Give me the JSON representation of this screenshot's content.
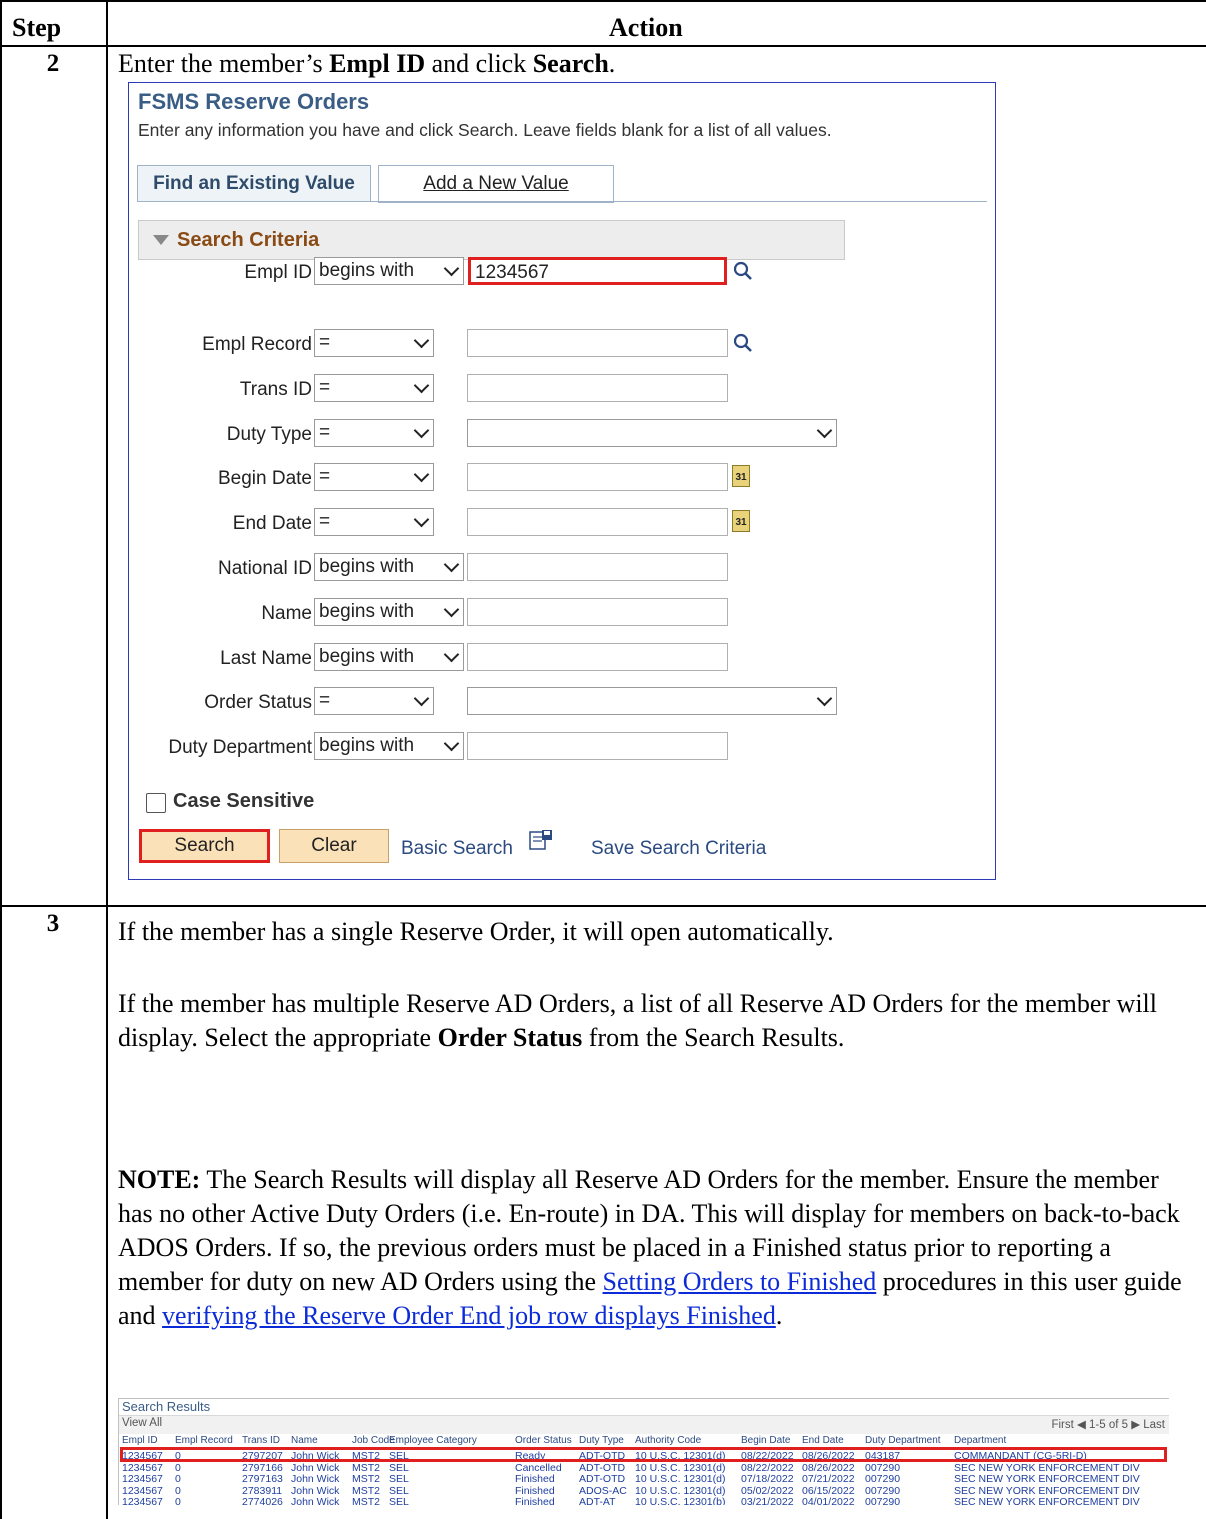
{
  "header": {
    "step": "Step",
    "action": "Action"
  },
  "step2": {
    "num": "2",
    "instr_pre": "Enter the member’s ",
    "instr_b1": "Empl ID",
    "instr_mid": " and click ",
    "instr_b2": "Search",
    "instr_end": "."
  },
  "ps": {
    "title": "FSMS Reserve Orders",
    "instructions": "Enter any information you have and click Search. Leave fields blank for a list of all values.",
    "tab_find": "Find an Existing Value",
    "tab_add": "Add a New Value",
    "criteria": "Search Criteria",
    "fields": [
      {
        "label": "Empl ID",
        "op": "begins with",
        "value": "1234567"
      },
      {
        "label": "Empl Record",
        "op": "=",
        "value": ""
      },
      {
        "label": "Trans ID",
        "op": "=",
        "value": ""
      },
      {
        "label": "Duty Type",
        "op": "=",
        "value": ""
      },
      {
        "label": "Begin Date",
        "op": "=",
        "value": ""
      },
      {
        "label": "End Date",
        "op": "=",
        "value": ""
      },
      {
        "label": "National ID",
        "op": "begins with",
        "value": ""
      },
      {
        "label": "Name",
        "op": "begins with",
        "value": ""
      },
      {
        "label": "Last Name",
        "op": "begins with",
        "value": ""
      },
      {
        "label": "Order Status",
        "op": "=",
        "value": ""
      },
      {
        "label": "Duty Department",
        "op": "begins with",
        "value": ""
      }
    ],
    "case_sensitive": "Case Sensitive",
    "search_btn": "Search",
    "clear_btn": "Clear",
    "basic_search": "Basic Search",
    "save_criteria": "Save Search Criteria",
    "calendar_glyph": "31"
  },
  "step3": {
    "num": "3",
    "p1": "If the member has a single Reserve Order, it will open automatically.",
    "p2_pre": "If the member has multiple Reserve AD Orders, a list of all Reserve AD Orders for the member will display. Select the appropriate ",
    "p2_b": "Order Status",
    "p2_post": " from the Search Results.",
    "note_b": "NOTE:",
    "note_1": " The Search Results will display all Reserve AD Orders for the member. Ensure the member has no other Active Duty Orders (i.e. En-route) in DA. This will display for members on back-to-back ADOS Orders. If so, the previous orders must be placed in a Finished status prior to reporting a member for duty on new AD Orders using the ",
    "note_link1": "Setting Orders to Finished",
    "note_2": " procedures in this user guide and ",
    "note_link2": "verifying the Reserve Order End job row displays Finished",
    "note_end": "."
  },
  "results": {
    "title": "Search Results",
    "view_all": "View All",
    "nav": "First  ◀  1-5 of 5  ▶  Last",
    "columns": [
      "Empl ID",
      "Empl Record",
      "Trans ID",
      "Name",
      "Job Code",
      "Employee Category",
      "Order Status",
      "Duty Type",
      "Authority Code",
      "Begin Date",
      "End Date",
      "Duty Department",
      "Department"
    ],
    "rows": [
      [
        "1234567",
        "0",
        "2797207",
        "John Wick",
        "MST2",
        "SEL",
        "Ready",
        "ADT-OTD",
        "10 U.S.C. 12301(d)",
        "08/22/2022",
        "08/26/2022",
        "043187",
        "COMMANDANT (CG-5RI-D)"
      ],
      [
        "1234567",
        "0",
        "2797166",
        "John Wick",
        "MST2",
        "SEL",
        "Cancelled",
        "ADT-OTD",
        "10 U.S.C. 12301(d)",
        "08/22/2022",
        "08/26/2022",
        "007290",
        "SEC NEW YORK ENFORCEMENT DIV"
      ],
      [
        "1234567",
        "0",
        "2797163",
        "John Wick",
        "MST2",
        "SEL",
        "Finished",
        "ADT-OTD",
        "10 U.S.C. 12301(d)",
        "07/18/2022",
        "07/21/2022",
        "007290",
        "SEC NEW YORK ENFORCEMENT DIV"
      ],
      [
        "1234567",
        "0",
        "2783911",
        "John Wick",
        "MST2",
        "SEL",
        "Finished",
        "ADOS-AC",
        "10 U.S.C. 12301(d)",
        "05/02/2022",
        "06/15/2022",
        "007290",
        "SEC NEW YORK ENFORCEMENT DIV"
      ],
      [
        "1234567",
        "0",
        "2774026",
        "John Wick",
        "MST2",
        "SEL",
        "Finished",
        "ADT-AT",
        "10 U.S.C. 12301(b)",
        "03/21/2022",
        "04/01/2022",
        "007290",
        "SEC NEW YORK ENFORCEMENT DIV"
      ]
    ]
  }
}
